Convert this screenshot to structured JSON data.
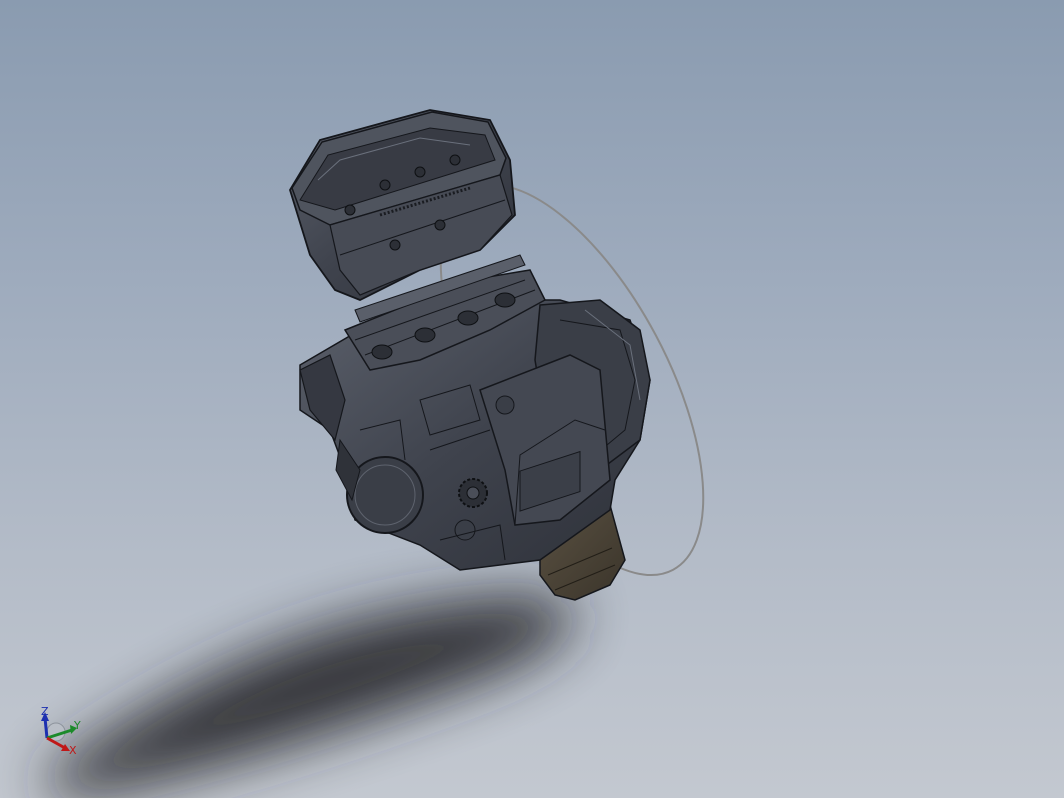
{
  "viewport": {
    "background_top": "#8a9bb0",
    "background_bottom": "#c3c8d0",
    "model": {
      "name": "engine-assembly",
      "body_color": "#3f434d",
      "edge_color": "#15171c",
      "highlight_color": "#6a707c",
      "oil_pan_color": "#4a4236",
      "selection_ellipse_color": "#8a8a8a"
    },
    "shadow_color": "#2a2c30"
  },
  "triad": {
    "x_label": "X",
    "y_label": "Y",
    "z_label": "Z",
    "x_color": "#c01818",
    "y_color": "#1c8a2a",
    "z_color": "#1c2fb0"
  }
}
